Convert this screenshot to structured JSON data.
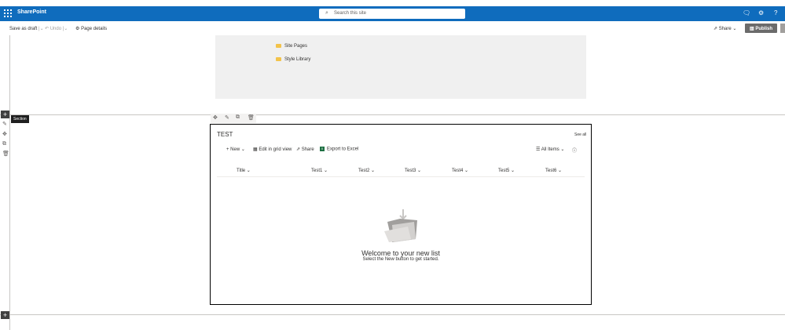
{
  "topbar": {
    "brand": "SharePoint",
    "search_placeholder": "Search this site"
  },
  "cmdbar": {
    "save_as_draft": "Save as draft",
    "undo": "Undo",
    "page_details": "Page details",
    "share": "Share",
    "publish": "Publish"
  },
  "folders": [
    "Site Pages",
    "Style Library"
  ],
  "section_tooltip": "Section",
  "list": {
    "title": "TEST",
    "see_all": "See all",
    "commands": {
      "new": "New",
      "edit_grid": "Edit in grid view",
      "share": "Share",
      "export": "Export to Excel",
      "view": "All Items"
    },
    "columns": [
      "Title",
      "Test1",
      "Test2",
      "Test3",
      "Test4",
      "Test5",
      "Test6"
    ],
    "empty_title": "Welcome to your new list",
    "empty_subtitle": "Select the New button to get started."
  },
  "colors": {
    "suite_bar": "#0f6cbd",
    "publish": "#6b6b6b",
    "excel": "#1d6f42",
    "folder": "#f3c34a"
  }
}
